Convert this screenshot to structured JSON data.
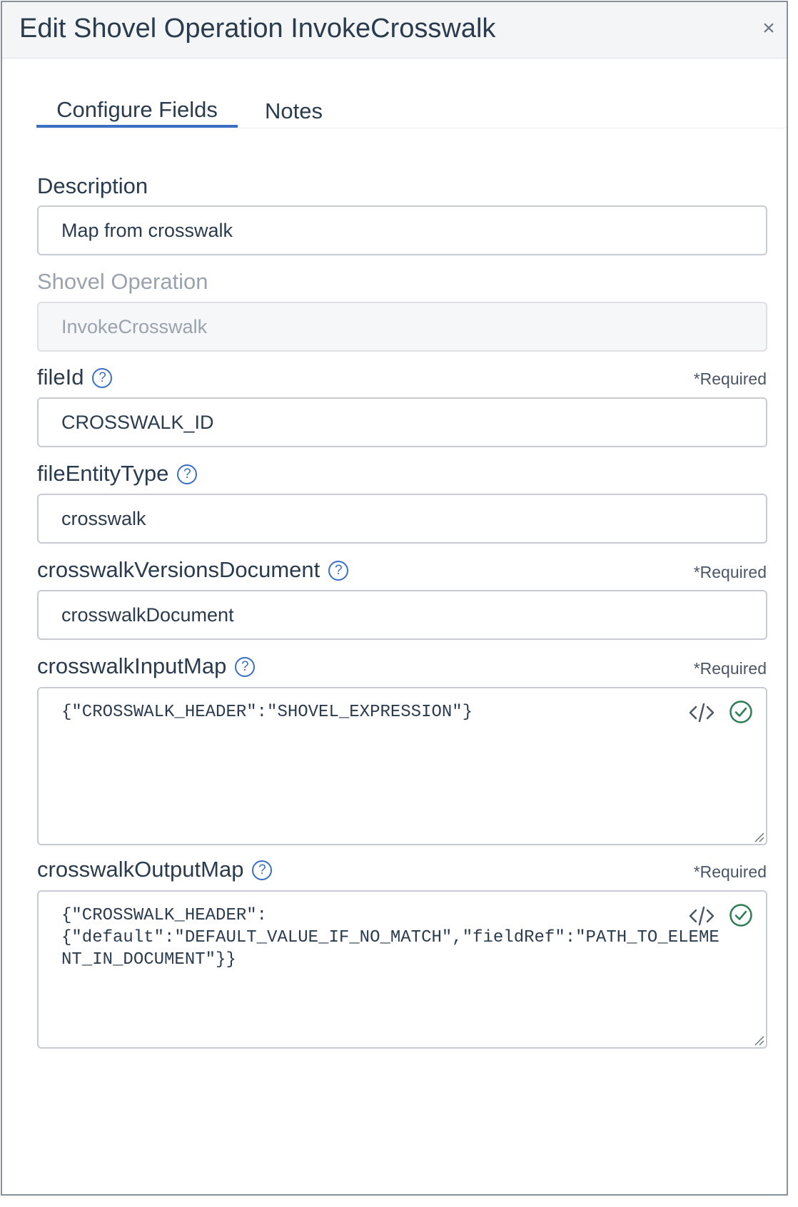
{
  "modal": {
    "title": "Edit Shovel Operation InvokeCrosswalk",
    "close_glyph": "×"
  },
  "tabs": [
    {
      "label": "Configure Fields",
      "active": true
    },
    {
      "label": "Notes",
      "active": false
    }
  ],
  "fields": {
    "description": {
      "label": "Description",
      "value": "Map from crosswalk"
    },
    "shovel_operation": {
      "label": "Shovel Operation",
      "value": "InvokeCrosswalk",
      "disabled": true
    },
    "file_id": {
      "label": "fileId",
      "required": "*Required",
      "value": "CROSSWALK_ID"
    },
    "file_entity_type": {
      "label": "fileEntityType",
      "value": "crosswalk"
    },
    "crosswalk_versions_document": {
      "label": "crosswalkVersionsDocument",
      "required": "*Required",
      "value": "crosswalkDocument"
    },
    "crosswalk_input_map": {
      "label": "crosswalkInputMap",
      "required": "*Required",
      "value": "{\"CROSSWALK_HEADER\":\"SHOVEL_EXPRESSION\"}"
    },
    "crosswalk_output_map": {
      "label": "crosswalkOutputMap",
      "required": "*Required",
      "value": "{\"CROSSWALK_HEADER\":\n{\"default\":\"DEFAULT_VALUE_IF_NO_MATCH\",\"fieldRef\":\"PATH_TO_ELEMENT_IN_DOCUMENT\"}}"
    }
  },
  "icons": {
    "help": "question-circle-icon",
    "help_glyph": "?",
    "code": "code-icon",
    "valid": "check-circle-icon",
    "close": "close-icon"
  },
  "colors": {
    "accent": "#3a6fc4",
    "valid": "#2e7d52",
    "text": "#2b3b4e",
    "disabled_text": "#9aa3ad"
  }
}
